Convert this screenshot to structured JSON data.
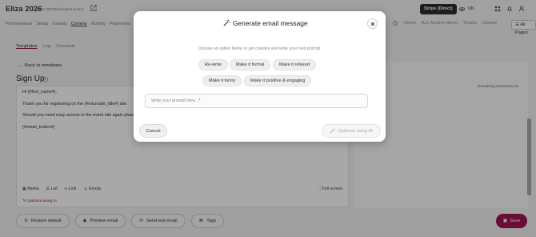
{
  "header": {
    "event_title": "Eliza 2026",
    "timezone": "(UTC+00:00) Europe/London",
    "payment_badge": "Stripe (Direct)",
    "language": "UK"
  },
  "main_nav": [
    "Performance",
    "Setup",
    "Guests",
    "Comms",
    "Activity",
    "Payments"
  ],
  "right_nav": [
    "Home",
    "ALL Auction items",
    "Tickets",
    "Donate"
  ],
  "all_pages_label": "All Pages",
  "sub_nav": [
    "Templates",
    "Log",
    "Schedule"
  ],
  "back_label": "Back to templates",
  "section_title": "Sign Up",
  "editor": {
    "lines": [
      "Hi {#first_name#},",
      "Thank you for registering on the {#microsite_title#} site.",
      "Should you need easy access to the event site again pleas",
      "{#email_button#}"
    ],
    "toolbar": [
      "Media",
      "List",
      "Link",
      "Emojis"
    ],
    "fullscreen_label": "Full screen",
    "optimize_link": "Optimize using AI"
  },
  "right_panel_text": "Remaining characters 32",
  "bottom_actions": [
    "Restore default",
    "Preview email",
    "Send test email",
    "Tags"
  ],
  "save_label": "Save",
  "modal": {
    "title": "Generate email message",
    "instructions": "Choose an option below or get creative and write your own prompt.",
    "options_row1": [
      "Re-write",
      "Make it formal",
      "Make it relaxed"
    ],
    "options_row2": [
      "Make it funny",
      "Make it positive & engaging"
    ],
    "prompt_placeholder": "Write your prompt here...",
    "required_mark": "*",
    "cancel_label": "Cancel",
    "optimize_label": "Optimize using AI"
  },
  "colors": {
    "accent": "#a0144f",
    "badge_bg": "#2d2d2d",
    "overlay": "rgba(0,0,0,0.34)"
  }
}
